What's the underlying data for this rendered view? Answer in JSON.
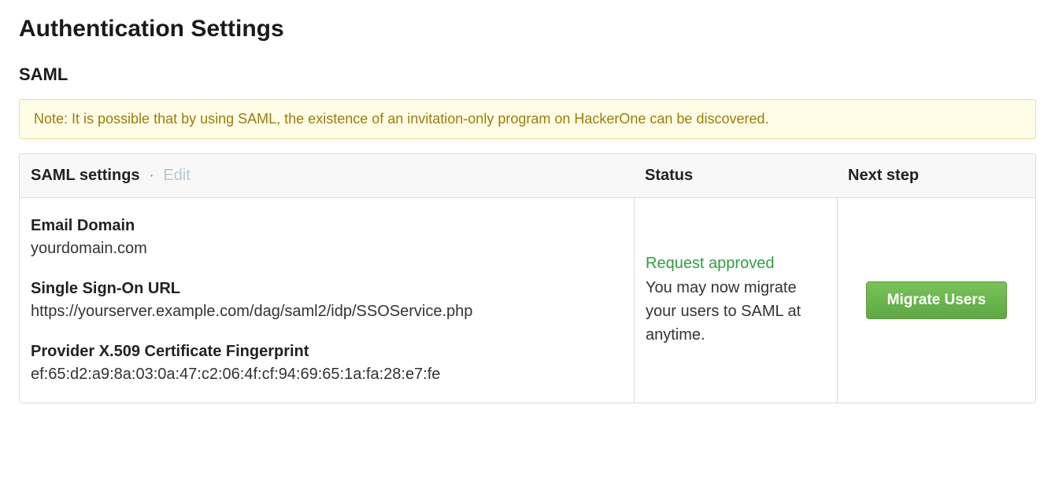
{
  "page_title": "Authentication Settings",
  "section_title": "SAML",
  "notice": "Note: It is possible that by using SAML, the existence of an invitation-only program on HackerOne can be discovered.",
  "table": {
    "header": {
      "settings_label": "SAML settings",
      "separator": "·",
      "edit_label": "Edit",
      "status_label": "Status",
      "next_step_label": "Next step"
    },
    "fields": {
      "email_domain": {
        "label": "Email Domain",
        "value": "yourdomain.com"
      },
      "sso_url": {
        "label": "Single Sign-On URL",
        "value": "https://yourserver.example.com/dag/saml2/idp/SSOService.php"
      },
      "cert_fingerprint": {
        "label": "Provider X.509 Certificate Fingerprint",
        "value": "ef:65:d2:a9:8a:03:0a:47:c2:06:4f:cf:94:69:65:1a:fa:28:e7:fe"
      }
    },
    "status": {
      "approved": "Request approved",
      "description": "You may now migrate your users to SAML at anytime."
    },
    "next_step": {
      "button_label": "Migrate Users"
    }
  }
}
